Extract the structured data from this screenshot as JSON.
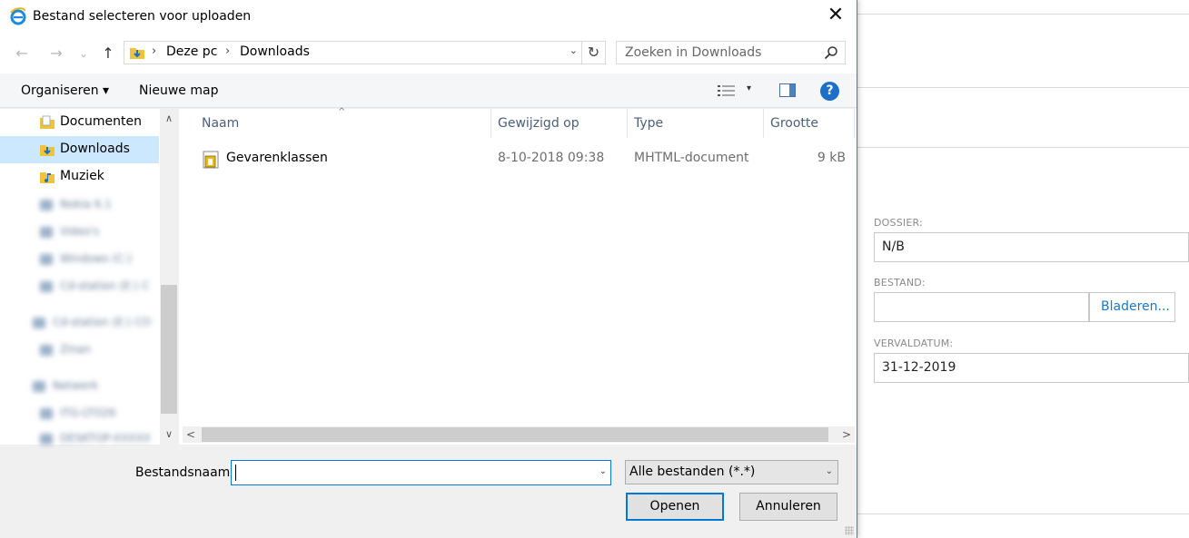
{
  "dialog": {
    "title": "Bestand selecteren voor uploaden",
    "close_glyph": "✕"
  },
  "nav_buttons": {
    "back": "←",
    "forward": "→",
    "history": "⌄",
    "up": "↑"
  },
  "address": {
    "crumbs": [
      "Deze pc",
      "Downloads"
    ],
    "separator": "›",
    "dropdown": "⌄",
    "refresh": "↻"
  },
  "search": {
    "placeholder": "Zoeken in Downloads"
  },
  "toolbar": {
    "organize": "Organiseren ▾",
    "new_folder": "Nieuwe map",
    "view_dropdown": "▾",
    "help": "?"
  },
  "nav_pane": {
    "items": [
      {
        "label": "Documenten",
        "icon": "documents-folder-icon",
        "selected": false
      },
      {
        "label": "Downloads",
        "icon": "downloads-folder-icon",
        "selected": true
      },
      {
        "label": "Muziek",
        "icon": "music-folder-icon",
        "selected": false
      }
    ],
    "blurred_items": [
      "Nokia 6.1",
      "Video's",
      "Windows (C:)",
      "Cd-station (E:) C",
      "Cd-station (E:) CO",
      "Zinan",
      "Netwerk",
      "ITG-LTO26",
      "DESKTOP-XXXXX"
    ],
    "scroll_up": "∧",
    "scroll_down": "∨"
  },
  "file_list": {
    "columns": [
      "Naam",
      "Gewijzigd op",
      "Type",
      "Grootte"
    ],
    "sort_indicator": "^",
    "rows": [
      {
        "name": "Gevarenklassen",
        "modified": "8-10-2018 09:38",
        "type": "MHTML-document",
        "size": "9 kB"
      }
    ],
    "scroll_left": "<",
    "scroll_right": ">"
  },
  "bottom": {
    "filename_label": "Bestandsnaam:",
    "filename_value": "",
    "filename_dropdown": "⌄",
    "filter_value": "Alle bestanden (*.*)",
    "filter_dropdown": "⌄",
    "open_label": "Openen",
    "cancel_label": "Annuleren"
  },
  "background_page": {
    "dossier_label": "DOSSIER:",
    "dossier_value": "N/B",
    "bestand_label": "BESTAND:",
    "browse_label": "Bladeren...",
    "vervaldatum_label": "VERVALDATUM:",
    "vervaldatum_value": "31-12-2019"
  },
  "colors": {
    "accent": "#0078d7",
    "selected_bg": "#cce8ff",
    "link": "#1b7ac2"
  }
}
